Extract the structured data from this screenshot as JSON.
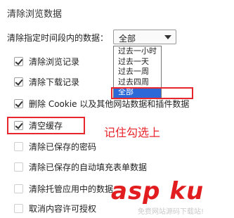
{
  "title": "清除浏览数据",
  "time_range": {
    "label": "清除指定时间段内的数据：",
    "selected": "全部",
    "options": [
      "过去一小时",
      "过去一天",
      "过去一周",
      "过去四周",
      "全部"
    ]
  },
  "checkboxes": [
    {
      "label": "清除浏览记录",
      "checked": true
    },
    {
      "label": "清除下载记录",
      "checked": true
    },
    {
      "label": "删除 Cookie 以及其他网站数据和插件数据",
      "checked": true
    },
    {
      "label": "清空缓存",
      "checked": true
    },
    {
      "label": "清除已保存的密码",
      "checked": false
    },
    {
      "label": "清除已保存的自动填充表单数据",
      "checked": false
    },
    {
      "label": "清除托管应用中的数据",
      "checked": false
    },
    {
      "label": "取消内容许可授权",
      "checked": false
    }
  ],
  "annotation": "记住勾选上",
  "watermark": {
    "main": "asp ku",
    "sub": "免费网站源码下载站!"
  },
  "colors": {
    "highlight_border": "#e8262d",
    "selected_option": "#2d68d8",
    "watermark": "#e11d20"
  }
}
